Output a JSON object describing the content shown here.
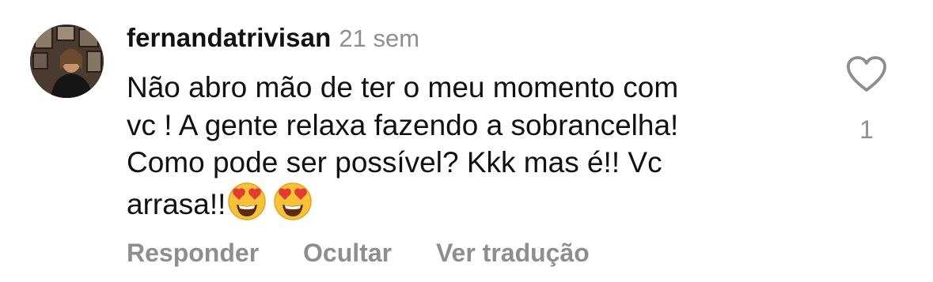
{
  "comment": {
    "username": "fernandatrivisan",
    "time": "21 sem",
    "text_lines": [
      "Não abro mão de ter o meu momento com",
      "vc ! A gente relaxa fazendo a sobrancelha!",
      "Como pode ser possível? Kkk mas é!! Vc",
      "arrasa!!"
    ],
    "emojis": [
      "heart-eyes-emoji",
      "heart-eyes-emoji"
    ],
    "like_count": "1",
    "like_icon": "heart-outline-icon",
    "actions": {
      "reply": "Responder",
      "hide": "Ocultar",
      "translate": "Ver tradução"
    }
  },
  "colors": {
    "text": "#111111",
    "secondary": "#8e8e8e",
    "background": "#ffffff"
  }
}
